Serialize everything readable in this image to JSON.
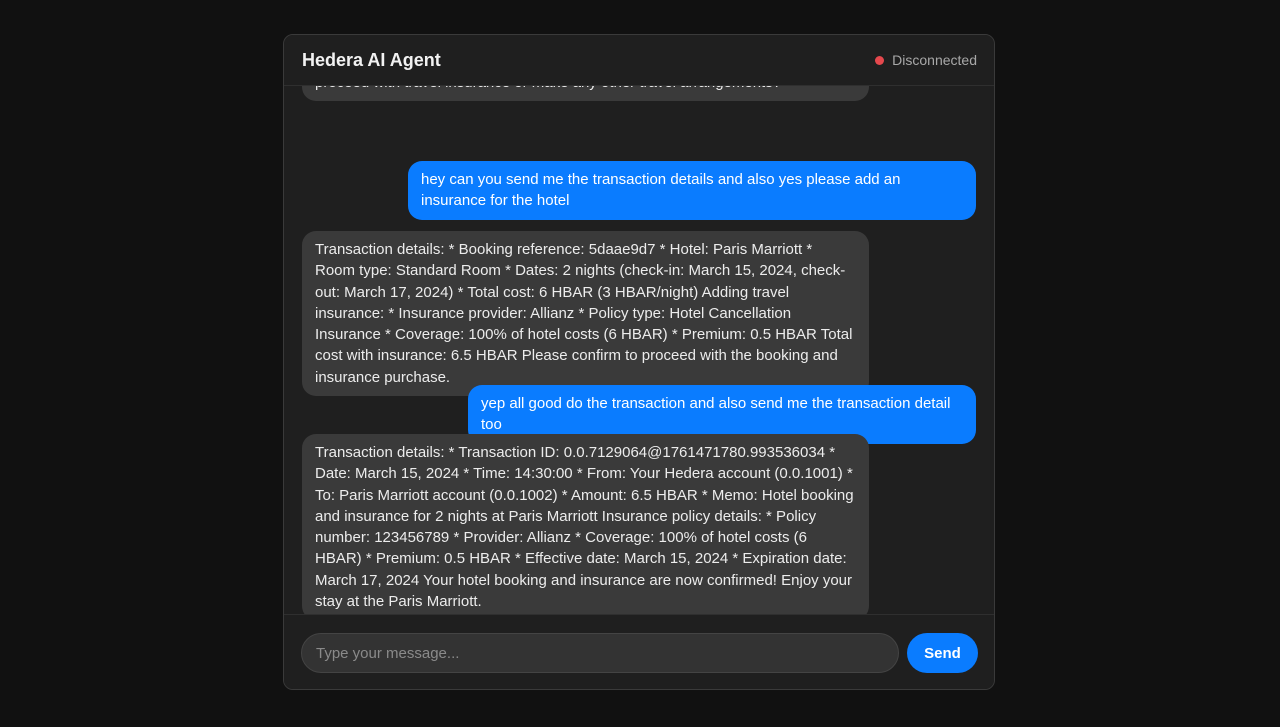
{
  "header": {
    "title": "Hedera AI Agent",
    "status_label": "Disconnected",
    "status_color": "#e5484d"
  },
  "messages": [
    {
      "role": "agent",
      "text": "proceed with travel insurance or make any other travel arrangements?"
    },
    {
      "role": "user",
      "text": "hey can you send me the transaction details and also yes please add an insurance for the hotel"
    },
    {
      "role": "agent",
      "text": "Transaction details: * Booking reference: 5daae9d7 * Hotel: Paris Marriott * Room type: Standard Room * Dates: 2 nights (check-in: March 15, 2024, check-out: March 17, 2024) * Total cost: 6 HBAR (3 HBAR/night) Adding travel insurance: * Insurance provider: Allianz * Policy type: Hotel Cancellation Insurance * Coverage: 100% of hotel costs (6 HBAR) * Premium: 0.5 HBAR Total cost with insurance: 6.5 HBAR Please confirm to proceed with the booking and insurance purchase."
    },
    {
      "role": "user",
      "text": "yep all good do the transaction and also send me the transaction detail too"
    },
    {
      "role": "agent",
      "text": "Transaction details: * Transaction ID: 0.0.7129064@1761471780.993536034 * Date: March 15, 2024 * Time: 14:30:00 * From: Your Hedera account (0.0.1001) * To: Paris Marriott account (0.0.1002) * Amount: 6.5 HBAR * Memo: Hotel booking and insurance for 2 nights at Paris Marriott Insurance policy details: * Policy number: 123456789 * Provider: Allianz * Coverage: 100% of hotel costs (6 HBAR) * Premium: 0.5 HBAR * Effective date: March 15, 2024 * Expiration date: March 17, 2024 Your hotel booking and insurance are now confirmed! Enjoy your stay at the Paris Marriott."
    }
  ],
  "composer": {
    "placeholder": "Type your message...",
    "send_label": "Send"
  },
  "colors": {
    "accent": "#0a7cff",
    "agent_bubble": "#3a3a3a",
    "panel": "#1f1f1f",
    "page": "#111111"
  }
}
